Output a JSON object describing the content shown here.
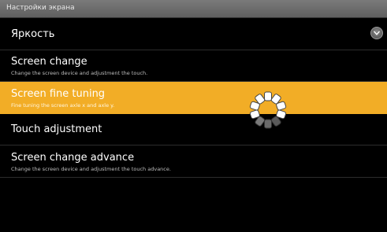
{
  "window": {
    "title": "Настройки экрана"
  },
  "items": [
    {
      "label": "Яркость",
      "summary": ""
    },
    {
      "label": "Screen change",
      "summary": "Change the screen device and adjustment the touch."
    },
    {
      "label": "Screen fine tuning",
      "summary": "Fine tuning the screen axle x and axle y."
    },
    {
      "label": "Touch adjustment",
      "summary": ""
    },
    {
      "label": "Screen change advance",
      "summary": "Change the screen device and adjustment the touch advance."
    }
  ],
  "icons": {
    "expand": "chevron-down-icon",
    "loading": "spinner-icon"
  },
  "colors": {
    "background": "#000000",
    "highlight": "#f2ad26",
    "title_bar": "#6b6b6b"
  }
}
